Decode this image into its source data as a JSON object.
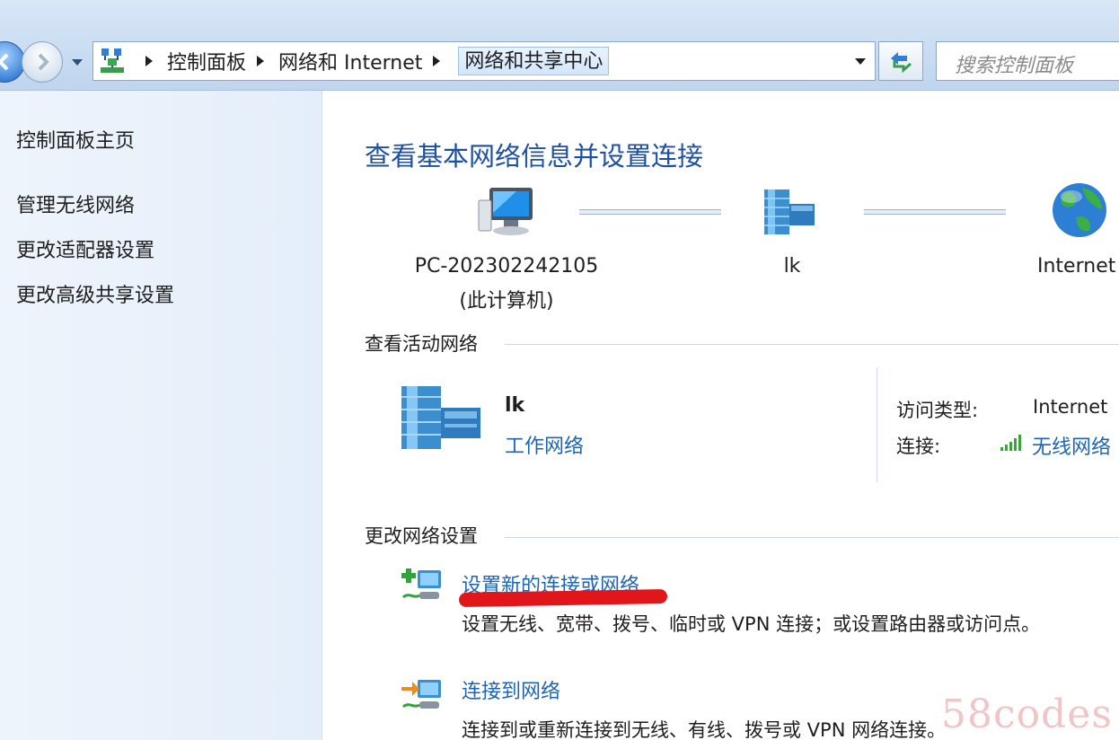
{
  "address_bar": {
    "root_icon": "control-panel-icon",
    "breadcrumbs": [
      "控制面板",
      "网络和 Internet",
      "网络和共享中心"
    ],
    "search_placeholder": "搜索控制面板"
  },
  "sidebar": {
    "items": [
      {
        "label": "控制面板主页"
      },
      {
        "label": "管理无线网络"
      },
      {
        "label": "更改适配器设置"
      },
      {
        "label": "更改高级共享设置"
      }
    ]
  },
  "main": {
    "title": "查看基本网络信息并设置连接",
    "network_map": {
      "nodes": [
        {
          "label": "PC-202302242105",
          "sublabel": "(此计算机)",
          "icon": "computer-icon"
        },
        {
          "label": "lk",
          "icon": "network-building-icon"
        },
        {
          "label": "Internet",
          "icon": "globe-icon"
        }
      ]
    },
    "active_networks": {
      "heading": "查看活动网络",
      "network": {
        "name": "lk",
        "category": "工作网络",
        "access_type_label": "访问类型:",
        "access_type_value": "Internet",
        "connection_label": "连接:",
        "connection_value": "无线网络",
        "signal_icon": "wifi-signal-icon"
      }
    },
    "change_settings": {
      "heading": "更改网络设置",
      "tasks": [
        {
          "title": "设置新的连接或网络",
          "description": "设置无线、宽带、拨号、临时或 VPN 连接；或设置路由器或访问点。",
          "icon": "new-connection-icon"
        },
        {
          "title": "连接到网络",
          "description": "连接到或重新连接到无线、有线、拨号或 VPN 网络连接。",
          "icon": "connect-network-icon"
        }
      ]
    }
  },
  "watermark": "58codes",
  "colors": {
    "link": "#1e64b4",
    "title": "#1e50a2",
    "annotation_red": "#e0161b"
  }
}
